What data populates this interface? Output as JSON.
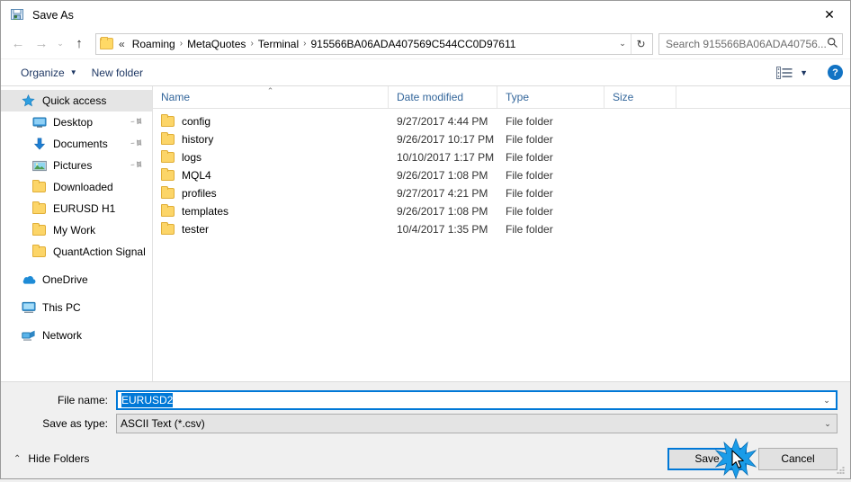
{
  "window": {
    "title": "Save As",
    "icon": "save-as-icon",
    "close_label": "✕"
  },
  "nav": {
    "back_icon": "←",
    "forward_icon": "→",
    "recent_icon": "⌄",
    "up_icon": "↑",
    "refresh_icon": "↻",
    "dropdown_icon": "⌄",
    "breadcrumb_lead": "«",
    "separator": "›",
    "breadcrumbs": [
      "Roaming",
      "MetaQuotes",
      "Terminal",
      "915566BA06ADA407569C544CC0D97611"
    ]
  },
  "search": {
    "placeholder": "Search 915566BA06ADA40756...",
    "icon": "⌕"
  },
  "toolbar": {
    "organize_label": "Organize",
    "organize_caret": "▼",
    "new_folder_label": "New folder",
    "view_caret": "▼",
    "help_label": "?"
  },
  "sidebar": {
    "items": [
      {
        "label": "Quick access",
        "icon": "star-icon",
        "selected": true,
        "indent": false,
        "pinned": false
      },
      {
        "label": "Desktop",
        "icon": "desktop-icon",
        "selected": false,
        "indent": true,
        "pinned": true
      },
      {
        "label": "Documents",
        "icon": "documents-icon",
        "selected": false,
        "indent": true,
        "pinned": true
      },
      {
        "label": "Pictures",
        "icon": "pictures-icon",
        "selected": false,
        "indent": true,
        "pinned": true
      },
      {
        "label": "Downloaded",
        "icon": "folder-icon",
        "selected": false,
        "indent": true,
        "pinned": false
      },
      {
        "label": "EURUSD H1",
        "icon": "folder-icon",
        "selected": false,
        "indent": true,
        "pinned": false
      },
      {
        "label": "My Work",
        "icon": "folder-icon",
        "selected": false,
        "indent": true,
        "pinned": false
      },
      {
        "label": "QuantAction Signal",
        "icon": "folder-icon",
        "selected": false,
        "indent": true,
        "pinned": false
      },
      {
        "label": "OneDrive",
        "icon": "onedrive-icon",
        "selected": false,
        "indent": false,
        "pinned": false,
        "gap_before": true
      },
      {
        "label": "This PC",
        "icon": "this-pc-icon",
        "selected": false,
        "indent": false,
        "pinned": false,
        "gap_before": true
      },
      {
        "label": "Network",
        "icon": "network-icon",
        "selected": false,
        "indent": false,
        "pinned": false,
        "gap_before": true
      }
    ],
    "pin_glyph": "📌"
  },
  "filelist": {
    "columns": [
      "Name",
      "Date modified",
      "Type",
      "Size"
    ],
    "sort_caret": "⌃",
    "rows": [
      {
        "name": "config",
        "date": "9/27/2017 4:44 PM",
        "type": "File folder",
        "size": ""
      },
      {
        "name": "history",
        "date": "9/26/2017 10:17 PM",
        "type": "File folder",
        "size": ""
      },
      {
        "name": "logs",
        "date": "10/10/2017 1:17 PM",
        "type": "File folder",
        "size": ""
      },
      {
        "name": "MQL4",
        "date": "9/26/2017 1:08 PM",
        "type": "File folder",
        "size": ""
      },
      {
        "name": "profiles",
        "date": "9/27/2017 4:21 PM",
        "type": "File folder",
        "size": ""
      },
      {
        "name": "templates",
        "date": "9/26/2017 1:08 PM",
        "type": "File folder",
        "size": ""
      },
      {
        "name": "tester",
        "date": "10/4/2017 1:35 PM",
        "type": "File folder",
        "size": ""
      }
    ]
  },
  "form": {
    "file_name_label": "File name:",
    "file_name_value": "EURUSD2",
    "save_as_type_label": "Save as type:",
    "save_as_type_value": "ASCII Text (*.csv)",
    "dropdown_icon": "⌄"
  },
  "footer": {
    "hide_folders_label": "Hide Folders",
    "hide_folders_chevron": "⌃",
    "save_label": "Save",
    "cancel_label": "Cancel"
  },
  "colors": {
    "accent": "#0078d7",
    "folder": "#fcd568",
    "crumb_text": "#000000",
    "header_text": "#33669b",
    "selection": "#e5e5e5",
    "click_burst": "#1a9ce8"
  }
}
